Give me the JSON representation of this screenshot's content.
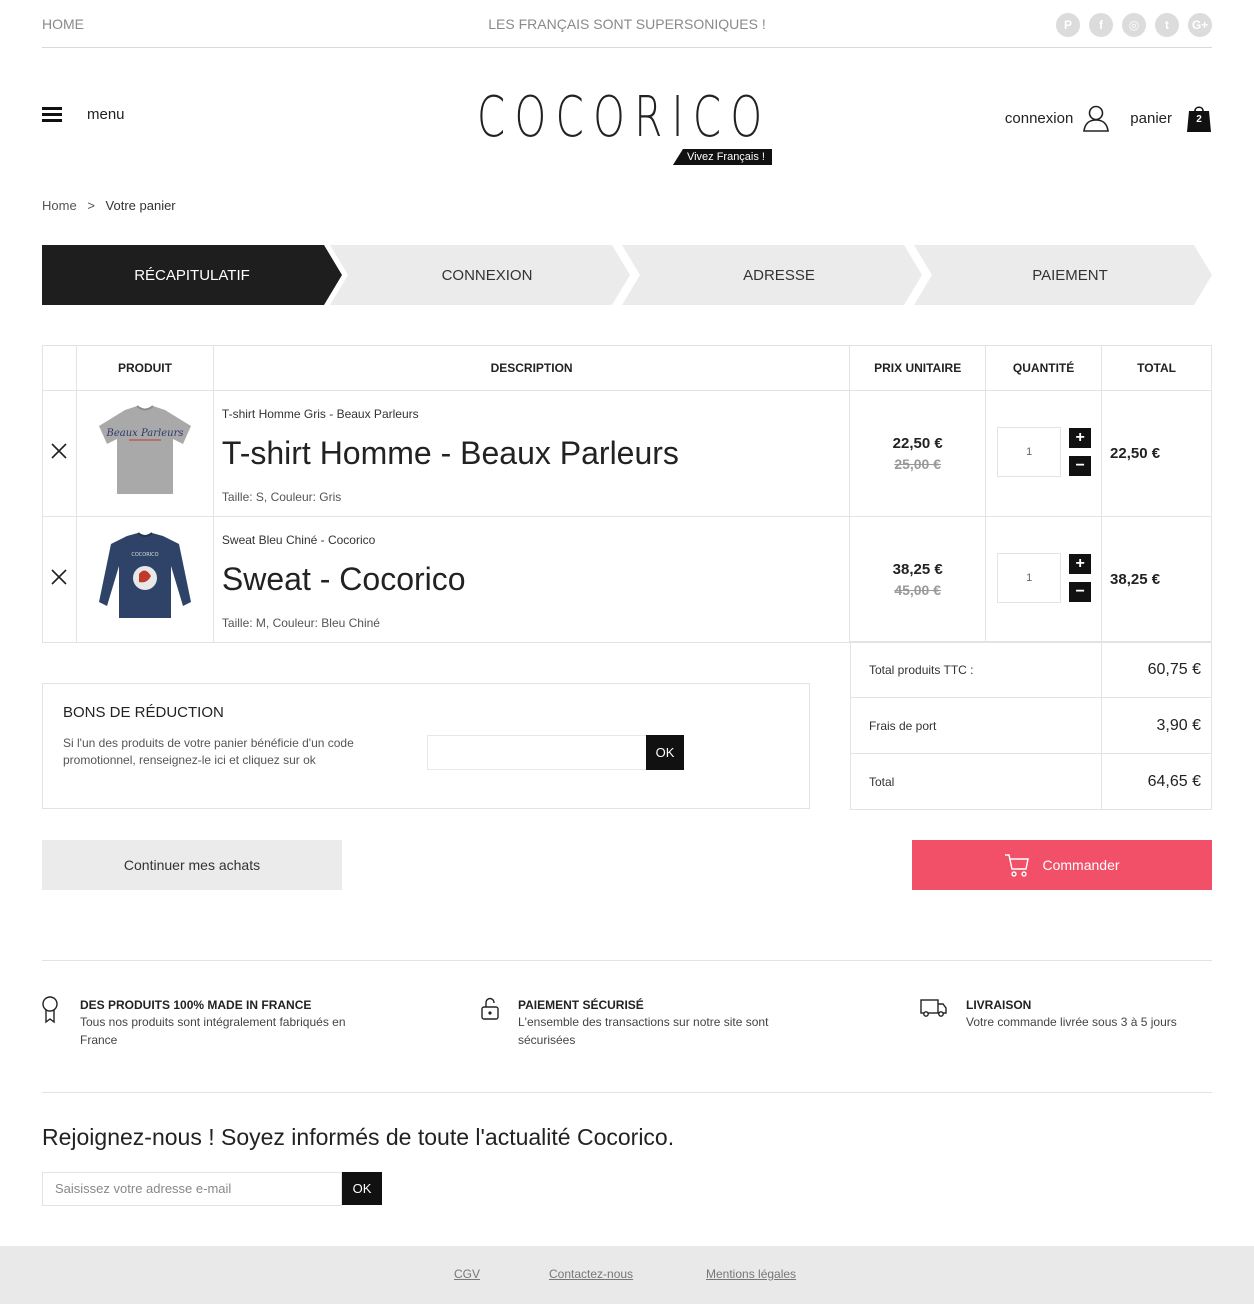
{
  "topbar": {
    "home": "HOME",
    "tagline": "LES FRANÇAIS SONT SUPERSONIQUES !",
    "socials": [
      {
        "icon": "pinterest-icon",
        "glyph": "P"
      },
      {
        "icon": "facebook-icon",
        "glyph": "f"
      },
      {
        "icon": "instagram-icon",
        "glyph": "◎"
      },
      {
        "icon": "twitter-icon",
        "glyph": "t"
      },
      {
        "icon": "google-plus-icon",
        "glyph": "G+"
      }
    ]
  },
  "header": {
    "menu_label": "menu",
    "logo_text": "COCORICO",
    "logo_badge": "Vivez Français !",
    "login_label": "connexion",
    "cart_label": "panier",
    "cart_count": "2"
  },
  "breadcrumb": {
    "home": "Home",
    "separator": ">",
    "current": "Votre panier"
  },
  "steps": [
    "RÉCAPITULATIF",
    "CONNEXION",
    "ADRESSE",
    "PAIEMENT"
  ],
  "cart": {
    "headers": {
      "product": "PRODUIT",
      "description": "DESCRIPTION",
      "unit_price": "PRIX UNITAIRE",
      "quantity": "QUANTITÉ",
      "total": "TOTAL"
    },
    "items": [
      {
        "subtitle": "T-shirt Homme Gris - Beaux Parleurs",
        "name": "T-shirt Homme - Beaux Parleurs",
        "attributes": "Taille: S, Couleur: Gris",
        "price": "22,50 €",
        "old_price": "25,00 €",
        "quantity": "1",
        "total": "22,50 €"
      },
      {
        "subtitle": "Sweat Bleu Chiné - Cocorico",
        "name": "Sweat - Cocorico",
        "attributes": "Taille: M, Couleur: Bleu Chiné",
        "price": "38,25 €",
        "old_price": "45,00 €",
        "quantity": "1",
        "total": "38,25 €"
      }
    ]
  },
  "totals": [
    {
      "label": "Total produits TTC :",
      "value": "60,75 €"
    },
    {
      "label": "Frais de port",
      "value": "3,90 €"
    },
    {
      "label": "Total",
      "value": "64,65 €"
    }
  ],
  "coupon": {
    "title": "BONS DE RÉDUCTION",
    "text": "Si l'un des produits de votre panier bénéficie d'un code promotionnel, renseignez-le ici et cliquez sur ok",
    "ok": "OK"
  },
  "actions": {
    "continue": "Continuer mes achats",
    "order": "Commander"
  },
  "features": [
    {
      "title": "DES PRODUITS 100% MADE IN FRANCE",
      "text": "Tous nos produits sont intégralement fabriqués en France"
    },
    {
      "title": "PAIEMENT SÉCURISÉ",
      "text": "L'ensemble des transactions sur notre site sont sécurisées"
    },
    {
      "title": "LIVRAISON",
      "text": "Votre commande livrée sous 3 à 5 jours"
    }
  ],
  "newsletter": {
    "title": "Rejoignez-nous ! Soyez informés de toute l'actualité Cocorico.",
    "placeholder": "Saisissez votre adresse e-mail",
    "ok": "OK"
  },
  "footer": {
    "links": [
      "CGV",
      "Contactez-nous",
      "Mentions légales"
    ]
  },
  "colors": {
    "accent": "#f15068",
    "dark": "#1e1e1e",
    "light_gray": "#ebebeb"
  }
}
